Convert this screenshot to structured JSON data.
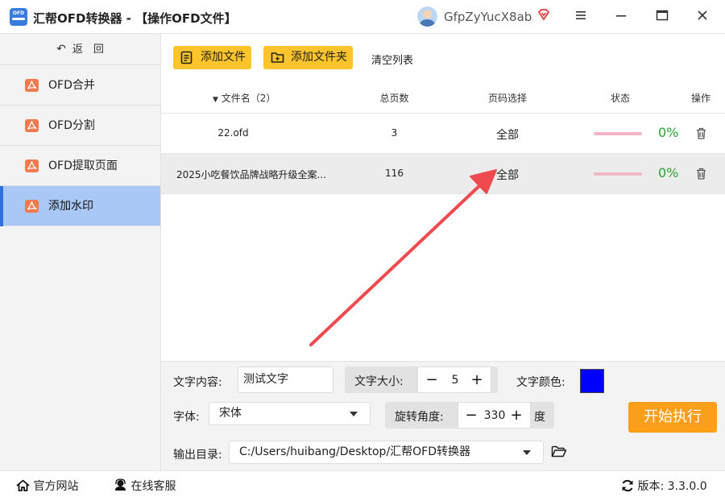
{
  "app": {
    "logo_text": "OFD",
    "title": "汇帮OFD转换器 - 【操作OFD文件】",
    "username": "GfpZyYucX8ab"
  },
  "window_controls": [
    "menu-icon",
    "minimize-icon",
    "maximize-icon",
    "close-icon"
  ],
  "sidebar": {
    "back_label": "返　回",
    "items": [
      {
        "label": "OFD合并",
        "active": false
      },
      {
        "label": "OFD分割",
        "active": false
      },
      {
        "label": "OFD提取页面",
        "active": false
      },
      {
        "label": "添加水印",
        "active": true
      }
    ]
  },
  "toolbar": {
    "add_file_label": "添加文件",
    "add_folder_label": "添加文件夹",
    "clear_label": "清空列表"
  },
  "table": {
    "headers": {
      "name": "文件名（2）",
      "pages": "总页数",
      "range": "页码选择",
      "status": "状态",
      "action": "操作"
    },
    "rows": [
      {
        "name": "22.ofd",
        "pages": "3",
        "range": "全部",
        "progress": 0,
        "percent": "0%"
      },
      {
        "name": "2025小吃餐饮品牌战略升级全案...",
        "pages": "116",
        "range": "全部",
        "progress": 0,
        "percent": "0%"
      }
    ]
  },
  "settings": {
    "text_content_label": "文字内容:",
    "text_content_value": "测试文字",
    "font_size_label": "文字大小:",
    "font_size_value": "5",
    "font_color_label": "文字颜色:",
    "font_color": "#0000ff",
    "font_label": "字体:",
    "font_value": "宋体",
    "rotation_label": "旋转角度:",
    "rotation_value": "330",
    "rotation_unit": "度",
    "output_label": "输出目录:",
    "output_path": "C:/Users/huibang/Desktop/汇帮OFD转换器",
    "start_label": "开始执行"
  },
  "statusbar": {
    "website_label": "官方网站",
    "support_label": "在线客服",
    "version_label": "版本:",
    "version_value": "3.3.0.0"
  },
  "colors": {
    "accent_yellow": "#fdc42b",
    "start_orange": "#fb9e1a",
    "active_nav": "#a9c8f5",
    "percent_green": "#2aa532",
    "annotation_arrow": "#ee4a4f"
  }
}
